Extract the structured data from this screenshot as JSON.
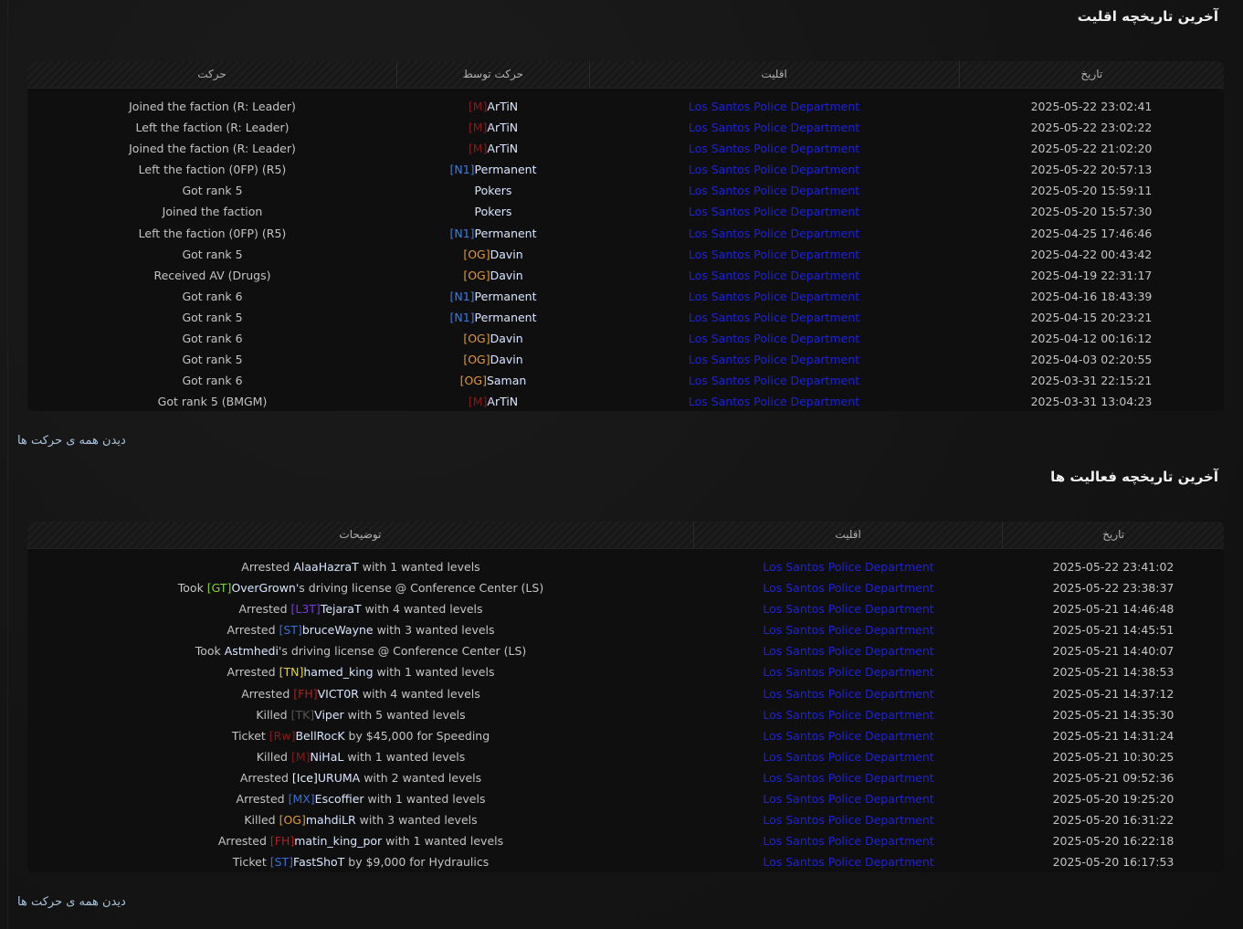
{
  "faction_history": {
    "title": "آخرین تاریخچه اقلیت",
    "headers": {
      "action": "حرکت",
      "by": "حرکت توسط",
      "faction": "اقلیت",
      "date": "تاریخ"
    },
    "see_all": "دیدن همه ی حرکت ها",
    "rows": [
      {
        "action": "Joined the faction (R: Leader)",
        "tag": "[M]",
        "tag_color": "#8b1a1a",
        "name": "ArTiN",
        "faction": "Los Santos Police Department",
        "date": "2025-05-22 23:02:41"
      },
      {
        "action": "Left the faction (R: Leader)",
        "tag": "[M]",
        "tag_color": "#8b1a1a",
        "name": "ArTiN",
        "faction": "Los Santos Police Department",
        "date": "2025-05-22 23:02:22"
      },
      {
        "action": "Joined the faction (R: Leader)",
        "tag": "[M]",
        "tag_color": "#8b1a1a",
        "name": "ArTiN",
        "faction": "Los Santos Police Department",
        "date": "2025-05-22 21:02:20"
      },
      {
        "action": "Left the faction (0FP) (R5)",
        "tag": "[N1]",
        "tag_color": "#3b7de0",
        "name": "Permanent",
        "faction": "Los Santos Police Department",
        "date": "2025-05-22 20:57:13"
      },
      {
        "action": "Got rank 5",
        "tag": "",
        "tag_color": "",
        "name": "Pokers",
        "faction": "Los Santos Police Department",
        "date": "2025-05-20 15:59:11"
      },
      {
        "action": "Joined the faction",
        "tag": "",
        "tag_color": "",
        "name": "Pokers",
        "faction": "Los Santos Police Department",
        "date": "2025-05-20 15:57:30"
      },
      {
        "action": "Left the faction (0FP) (R5)",
        "tag": "[N1]",
        "tag_color": "#3b7de0",
        "name": "Permanent",
        "faction": "Los Santos Police Department",
        "date": "2025-04-25 17:46:46"
      },
      {
        "action": "Got rank 5",
        "tag": "[OG]",
        "tag_color": "#e09a3b",
        "name": "Davin",
        "faction": "Los Santos Police Department",
        "date": "2025-04-22 00:43:42"
      },
      {
        "action": "Received AV (Drugs)",
        "tag": "[OG]",
        "tag_color": "#e09a3b",
        "name": "Davin",
        "faction": "Los Santos Police Department",
        "date": "2025-04-19 22:31:17"
      },
      {
        "action": "Got rank 6",
        "tag": "[N1]",
        "tag_color": "#3b7de0",
        "name": "Permanent",
        "faction": "Los Santos Police Department",
        "date": "2025-04-16 18:43:39"
      },
      {
        "action": "Got rank 5",
        "tag": "[N1]",
        "tag_color": "#3b7de0",
        "name": "Permanent",
        "faction": "Los Santos Police Department",
        "date": "2025-04-15 20:23:21"
      },
      {
        "action": "Got rank 6",
        "tag": "[OG]",
        "tag_color": "#e09a3b",
        "name": "Davin",
        "faction": "Los Santos Police Department",
        "date": "2025-04-12 00:16:12"
      },
      {
        "action": "Got rank 5",
        "tag": "[OG]",
        "tag_color": "#e09a3b",
        "name": "Davin",
        "faction": "Los Santos Police Department",
        "date": "2025-04-03 02:20:55"
      },
      {
        "action": "Got rank 6",
        "tag": "[OG]",
        "tag_color": "#e09a3b",
        "name": "Saman",
        "faction": "Los Santos Police Department",
        "date": "2025-03-31 22:15:21"
      },
      {
        "action": "Got rank 5 (BMGM)",
        "tag": "[M]",
        "tag_color": "#8b1a1a",
        "name": "ArTiN",
        "faction": "Los Santos Police Department",
        "date": "2025-03-31 13:04:23"
      }
    ]
  },
  "activity_history": {
    "title": "آخرین تاریخچه فعالیت ها",
    "headers": {
      "description": "توضیحات",
      "faction": "اقلیت",
      "date": "تاریخ"
    },
    "see_all": "دیدن همه ی حرکت ها",
    "rows": [
      {
        "pre": "Arrested ",
        "tag": "",
        "tag_color": "",
        "name": "AlaaHazraT",
        "post": " with 1 wanted levels",
        "faction": "Los Santos Police Department",
        "date": "2025-05-22 23:41:02"
      },
      {
        "pre": "Took ",
        "tag": "[GT]",
        "tag_color": "#7fd43a",
        "name": "OverGrown",
        "post": "'s driving license @ Conference Center (LS)",
        "faction": "Los Santos Police Department",
        "date": "2025-05-22 23:38:37"
      },
      {
        "pre": "Arrested ",
        "tag": "[L3T]",
        "tag_color": "#7a3be0",
        "name": "TejaraT",
        "post": " with 4 wanted levels",
        "faction": "Los Santos Police Department",
        "date": "2025-05-21 14:46:48"
      },
      {
        "pre": "Arrested ",
        "tag": "[ST]",
        "tag_color": "#3b6fd4",
        "name": "bruceWayne",
        "post": " with 3 wanted levels",
        "faction": "Los Santos Police Department",
        "date": "2025-05-21 14:45:51"
      },
      {
        "pre": "Took ",
        "tag": "",
        "tag_color": "",
        "name": "Astmhedi",
        "post": "'s driving license @ Conference Center (LS)",
        "faction": "Los Santos Police Department",
        "date": "2025-05-21 14:40:07"
      },
      {
        "pre": "Arrested ",
        "tag": "[TN]",
        "tag_color": "#e6d43a",
        "name": "hamed_king",
        "post": " with 1 wanted levels",
        "faction": "Los Santos Police Department",
        "date": "2025-05-21 14:38:53"
      },
      {
        "pre": "Arrested ",
        "tag": "[FH]",
        "tag_color": "#b02020",
        "name": "VICT0R",
        "post": " with 4 wanted levels",
        "faction": "Los Santos Police Department",
        "date": "2025-05-21 14:37:12"
      },
      {
        "pre": "Killed ",
        "tag": "[TK]",
        "tag_color": "#555555",
        "name": "Viper",
        "post": " with 5 wanted levels",
        "faction": "Los Santos Police Department",
        "date": "2025-05-21 14:35:30"
      },
      {
        "pre": "Ticket ",
        "tag": "[Rw]",
        "tag_color": "#8b1a1a",
        "name": "BellRocK",
        "post": " by $45,000 for Speeding",
        "faction": "Los Santos Police Department",
        "date": "2025-05-21 14:31:24"
      },
      {
        "pre": "Killed ",
        "tag": "[M]",
        "tag_color": "#8b1a1a",
        "name": "NiHaL",
        "post": " with 1 wanted levels",
        "faction": "Los Santos Police Department",
        "date": "2025-05-21 10:30:25"
      },
      {
        "pre": "Arrested ",
        "tag": "[Ice]",
        "tag_color": "#e8f4ff",
        "name": "URUMA",
        "post": " with 2 wanted levels",
        "faction": "Los Santos Police Department",
        "date": "2025-05-21 09:52:36"
      },
      {
        "pre": "Arrested ",
        "tag": "[MX]",
        "tag_color": "#3b6fd4",
        "name": "Escoffier",
        "post": " with 1 wanted levels",
        "faction": "Los Santos Police Department",
        "date": "2025-05-20 19:25:20"
      },
      {
        "pre": "Killed ",
        "tag": "[OG]",
        "tag_color": "#e09a3b",
        "name": "mahdiLR",
        "post": " with 3 wanted levels",
        "faction": "Los Santos Police Department",
        "date": "2025-05-20 16:31:22"
      },
      {
        "pre": "Arrested ",
        "tag": "[FH]",
        "tag_color": "#b02020",
        "name": "matin_king_por",
        "post": " with 1 wanted levels",
        "faction": "Los Santos Police Department",
        "date": "2025-05-20 16:22:18"
      },
      {
        "pre": "Ticket ",
        "tag": "[ST]",
        "tag_color": "#3b6fd4",
        "name": "FastShoT",
        "post": " by $9,000 for Hydraulics",
        "faction": "Los Santos Police Department",
        "date": "2025-05-20 16:17:53"
      }
    ]
  }
}
